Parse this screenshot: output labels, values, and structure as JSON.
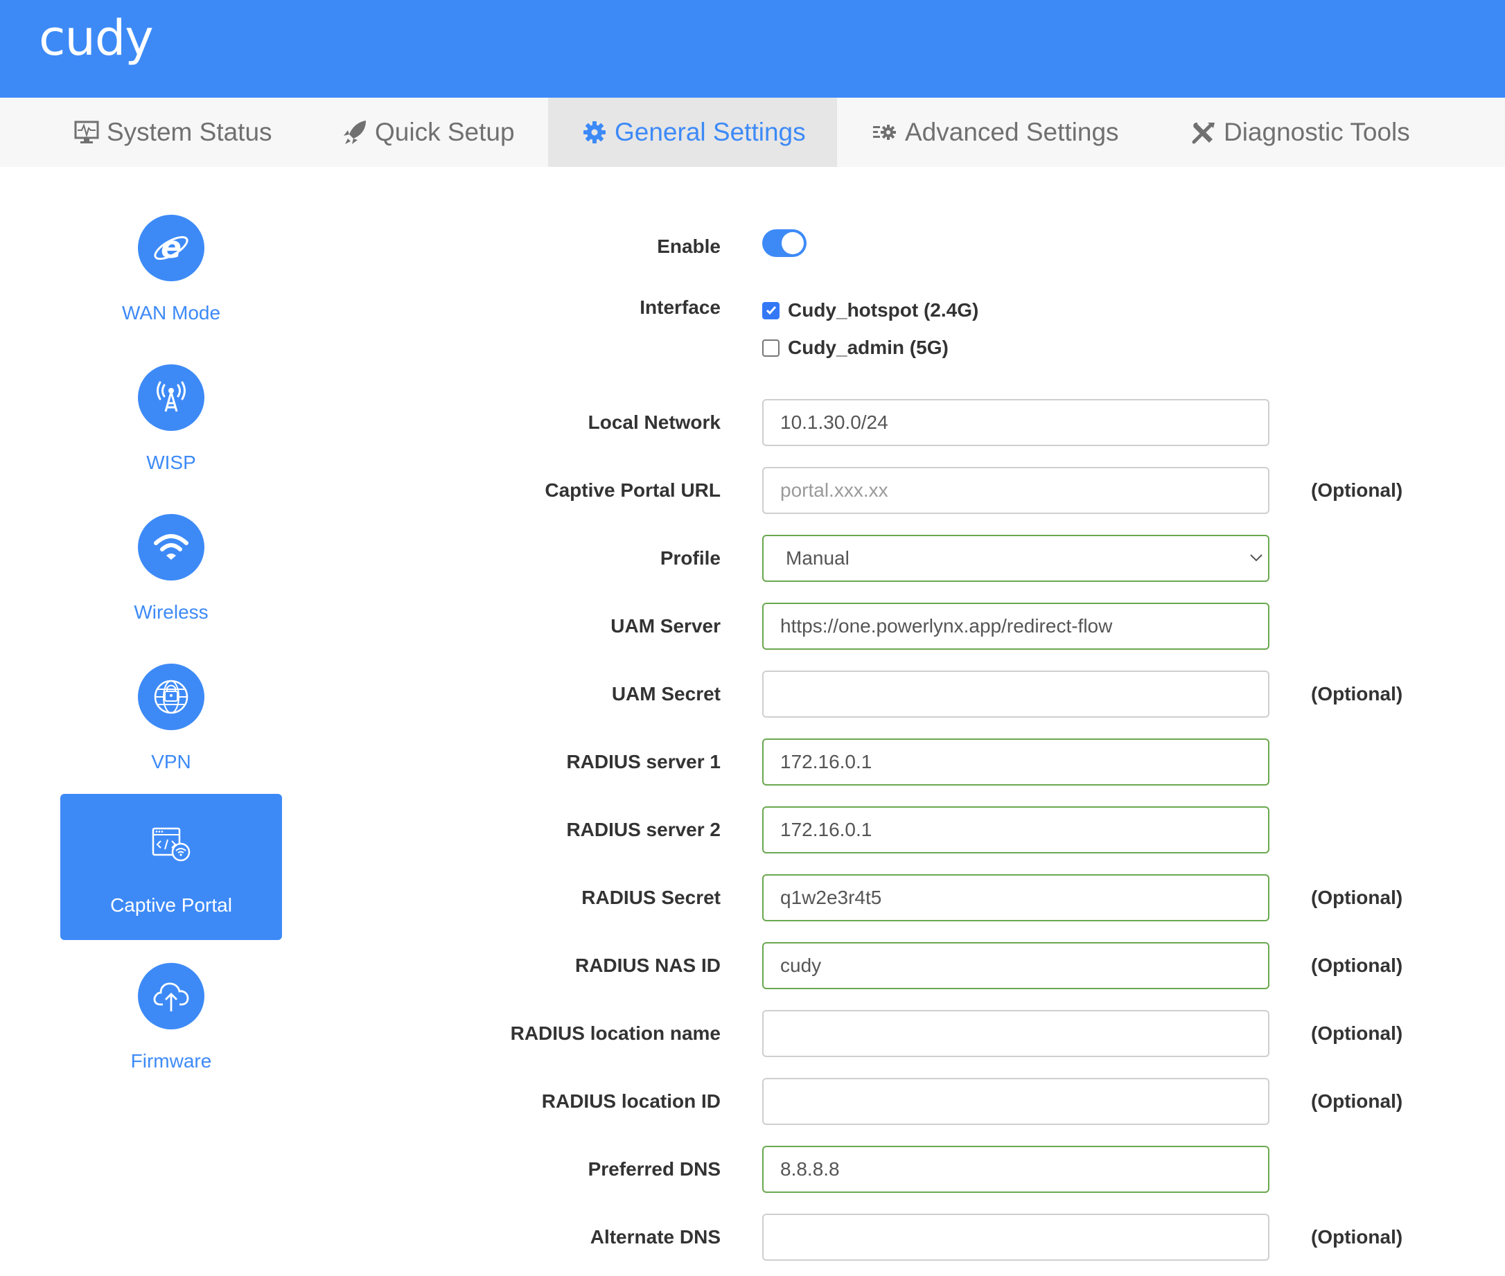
{
  "header": {
    "logo_text": "cudy",
    "brand_color": "#3d8af7"
  },
  "nav": {
    "tabs": [
      {
        "label": "System Status",
        "icon": "monitor-pulse-icon",
        "active": false
      },
      {
        "label": "Quick Setup",
        "icon": "rocket-icon",
        "active": false
      },
      {
        "label": "General Settings",
        "icon": "gear-icon",
        "active": true
      },
      {
        "label": "Advanced Settings",
        "icon": "list-gear-icon",
        "active": false
      },
      {
        "label": "Diagnostic Tools",
        "icon": "wrench-screwdriver-icon",
        "active": false
      }
    ]
  },
  "sidebar": {
    "items": [
      {
        "label": "WAN Mode",
        "icon": "internet-explorer-icon",
        "active": false
      },
      {
        "label": "WISP",
        "icon": "antenna-tower-icon",
        "active": false
      },
      {
        "label": "Wireless",
        "icon": "wifi-icon",
        "active": false
      },
      {
        "label": "VPN",
        "icon": "globe-lock-icon",
        "active": false
      },
      {
        "label": "Captive Portal",
        "icon": "browser-code-wifi-icon",
        "active": true
      },
      {
        "label": "Firmware",
        "icon": "cloud-upload-icon",
        "active": false
      }
    ]
  },
  "form": {
    "enable": {
      "label": "Enable",
      "value": true
    },
    "interface": {
      "label": "Interface",
      "options": [
        {
          "label": "Cudy_hotspot (2.4G)",
          "checked": true
        },
        {
          "label": "Cudy_admin (5G)",
          "checked": false
        }
      ]
    },
    "optional_text": "(Optional)",
    "fields": [
      {
        "label": "Local Network",
        "value": "10.1.30.0/24",
        "placeholder": "",
        "optional": false,
        "valid": false
      },
      {
        "label": "Captive Portal URL",
        "value": "",
        "placeholder": "portal.xxx.xx",
        "optional": true,
        "valid": false
      },
      {
        "label": "Profile",
        "value": "Manual",
        "type": "select",
        "optional": false,
        "valid": true
      },
      {
        "label": "UAM Server",
        "value": "https://one.powerlynx.app/redirect-flow",
        "placeholder": "",
        "optional": false,
        "valid": true
      },
      {
        "label": "UAM Secret",
        "value": "",
        "placeholder": "",
        "optional": true,
        "valid": false
      },
      {
        "label": "RADIUS server 1",
        "value": "172.16.0.1",
        "placeholder": "",
        "optional": false,
        "valid": true
      },
      {
        "label": "RADIUS server 2",
        "value": "172.16.0.1",
        "placeholder": "",
        "optional": false,
        "valid": true
      },
      {
        "label": "RADIUS Secret",
        "value": "q1w2e3r4t5",
        "placeholder": "",
        "optional": true,
        "valid": true
      },
      {
        "label": "RADIUS NAS ID",
        "value": "cudy",
        "placeholder": "",
        "optional": true,
        "valid": true
      },
      {
        "label": "RADIUS location name",
        "value": "",
        "placeholder": "",
        "optional": true,
        "valid": false
      },
      {
        "label": "RADIUS location ID",
        "value": "",
        "placeholder": "",
        "optional": true,
        "valid": false
      },
      {
        "label": "Preferred DNS",
        "value": "8.8.8.8",
        "placeholder": "",
        "optional": false,
        "valid": true
      },
      {
        "label": "Alternate DNS",
        "value": "",
        "placeholder": "",
        "optional": true,
        "valid": false
      }
    ]
  }
}
